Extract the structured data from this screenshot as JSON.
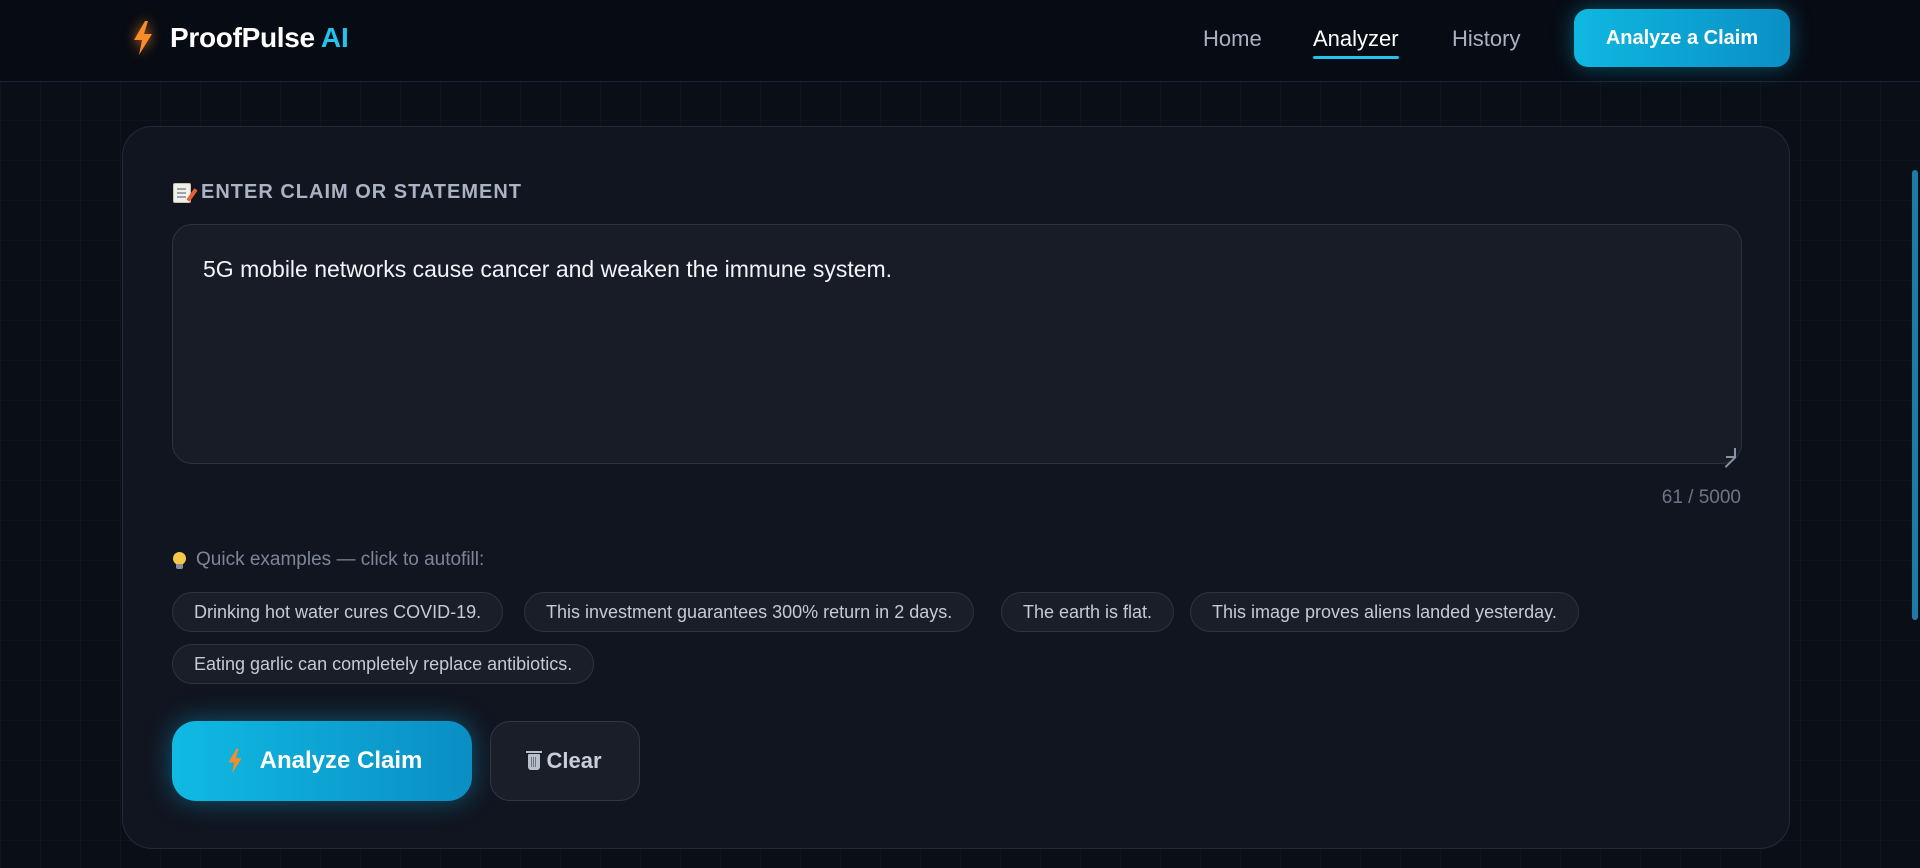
{
  "brand": {
    "name": "ProofPulse",
    "suffix": "AI"
  },
  "nav": {
    "links": [
      {
        "label": "Home",
        "active": false
      },
      {
        "label": "Analyzer",
        "active": true
      },
      {
        "label": "History",
        "active": false
      }
    ],
    "cta_label": "Analyze a Claim"
  },
  "form": {
    "section_label": "ENTER CLAIM OR STATEMENT",
    "claim_value": "5G mobile networks cause cancer and weaken the immune system.",
    "char_count": "61 / 5000",
    "examples_label": "Quick examples — click to autofill:",
    "examples": [
      "Drinking hot water cures COVID-19.",
      "This investment guarantees 300% return in 2 days.",
      "The earth is flat.",
      "This image proves aliens landed yesterday.",
      "Eating garlic can completely replace antibiotics."
    ],
    "analyze_label": "Analyze Claim",
    "clear_label": "Clear"
  },
  "colors": {
    "accent": "#22c3ee",
    "bolt": "#f98c28",
    "background": "#0a0e17",
    "card": "#111520"
  },
  "icons": [
    "bolt-icon",
    "memo-icon",
    "bulb-icon",
    "trash-icon"
  ]
}
